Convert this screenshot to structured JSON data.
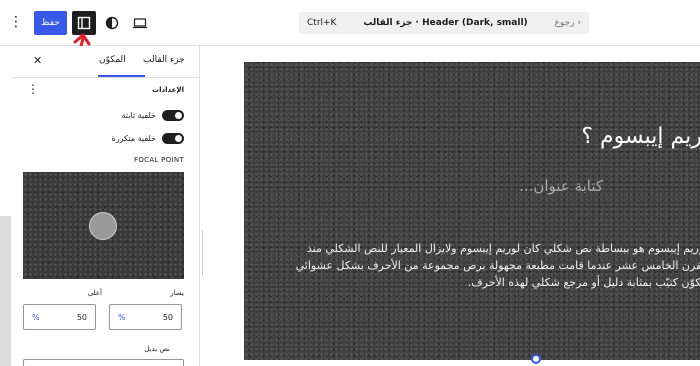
{
  "toolbar": {
    "save_label": "حفظ",
    "command_title": "جزء القالب · Header (Dark, small)",
    "command_back": "رجوع",
    "command_shortcut": "Ctrl+K"
  },
  "sidebar": {
    "tabs": [
      {
        "label": "جزء القالب"
      },
      {
        "label": "المكوّن"
      }
    ],
    "settings_title": "الإعدادات",
    "toggle_fixed": "خلفية ثابتة",
    "toggle_repeated": "خلفية متكررة",
    "focal_label": "FOCAL POINT",
    "left_label": "يسار",
    "top_label": "أعلى",
    "left_value": "50",
    "top_value": "50",
    "unit": "%",
    "alt_label": "نص بديل"
  },
  "canvas": {
    "hero_title": "لوريم إيبسوم ؟",
    "hero_subtitle": "كتابة عنوان...",
    "hero_lines": [
      "لوريم إيبسوم هو ببساطة نص شكلي كان لوريم إيبسوم ولايزال المعيار للنص الشكلي منذ",
      "القرن الخامس عشر عندما قامت مطبعة مجهولة برص مجموعة من الأحرف بشكل عشوائي",
      "لتكوّن كتيّب بمثابة دليل أو مرجع شكلي لهذه الأحرف."
    ]
  },
  "colors": {
    "accent": "#3858e9",
    "annotation": "#e0202a"
  }
}
